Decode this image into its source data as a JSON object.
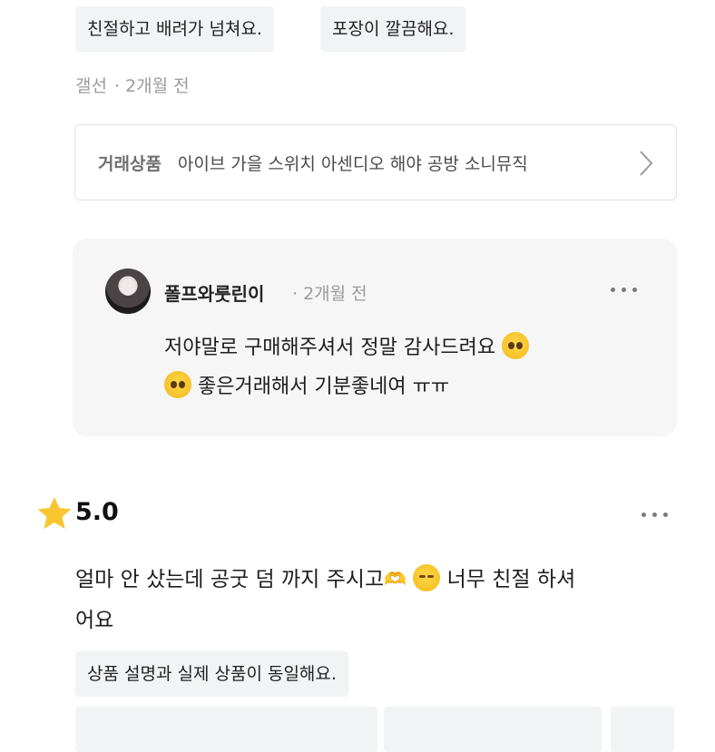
{
  "top_tags": [
    "친절하고 배려가 넘쳐요.",
    "포장이 깔끔해요."
  ],
  "review1": {
    "author": "갤선",
    "time": "2개월 전",
    "product_label": "거래상품",
    "product_name": "아이브 가을 스위치 아센디오 해야 공방 소니뮤직"
  },
  "reply": {
    "author": "폴프와룻린이",
    "time": "2개월 전",
    "text_line1": "저야말로 구매해주셔서 정말 감사드려요",
    "text_line2": "좋은거래해서 기분좋네여 ㅠㅠ",
    "emoji": "pleading-face-emoji"
  },
  "review2": {
    "rating": "5.0",
    "text_part1": "얼마 안 샀는데 공굿 덤 까지 주시고",
    "text_part2": "너무 친절 하셔",
    "text_part3": "어요",
    "hands_emoji": "heart-hands-emoji",
    "smile_emoji": "smiling-face-emoji",
    "tag": "상품 설명과 실제 상품이 동일해요."
  },
  "colors": {
    "tag_bg": "#f2f3f5",
    "meta_gray": "#9b9b9b",
    "reply_bg": "#f6f6f7",
    "star": "#f7c631"
  }
}
